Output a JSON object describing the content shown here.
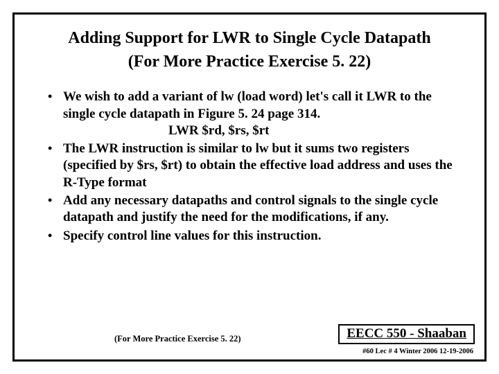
{
  "title": {
    "line1": "Adding Support for LWR to Single Cycle Datapath",
    "line2": "(For More Practice Exercise 5. 22)"
  },
  "bullets": {
    "b1": "We wish to add  a variant of lw (load word)  let's call it LWR to the single cycle datapath in Figure 5. 24 page 314.",
    "b1_indent": "LWR   $rd, $rs,  $rt",
    "b2": "The LWR instruction is similar to lw but it sums two registers (specified by $rs, $rt) to obtain the effective load address and uses the R-Type format",
    "b3": "Add any necessary datapaths and control signals to the single cycle datapath and justify the need for the modifications, if any.",
    "b4": "Specify control line values for this instruction."
  },
  "footer": {
    "note": "(For More Practice Exercise 5. 22)",
    "course": "EECC 550 - Shaaban",
    "meta": "#60   Lec # 4   Winter 2006  12-19-2006"
  }
}
